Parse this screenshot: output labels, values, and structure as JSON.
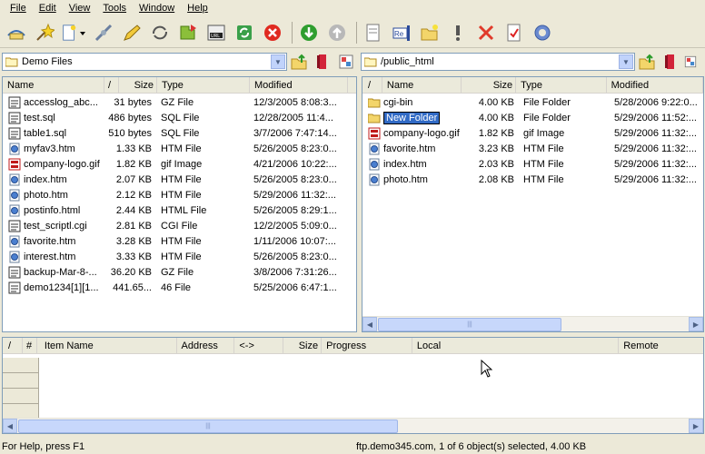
{
  "menu": [
    "File",
    "Edit",
    "View",
    "Tools",
    "Window",
    "Help"
  ],
  "toolbar_icons": [
    "connect-icon",
    "wizard-icon",
    "new-file-icon",
    "dropdown-arrow-icon",
    "disconnect-icon",
    "pencil-icon",
    "reconnect-icon",
    "transfer-icon",
    "url-icon",
    "refresh-icon",
    "stop-icon",
    "download-icon",
    "upload-icon",
    "properties-icon",
    "rename-icon",
    "new-folder-icon",
    "exclamation-icon",
    "delete-icon",
    "edit-icon",
    "settings-icon"
  ],
  "left": {
    "path": "Demo Files",
    "columns": [
      "Name",
      "/",
      "Size",
      "Type",
      "Modified"
    ],
    "files": [
      {
        "name": "accesslog_abc...",
        "size": "31 bytes",
        "type": "GZ File",
        "modified": "12/3/2005 8:08:3...",
        "icon": "gz"
      },
      {
        "name": "test.sql",
        "size": "486 bytes",
        "type": "SQL File",
        "modified": "12/28/2005 11:4...",
        "icon": "gz"
      },
      {
        "name": "table1.sql",
        "size": "510 bytes",
        "type": "SQL File",
        "modified": "3/7/2006 7:47:14...",
        "icon": "gz"
      },
      {
        "name": "myfav3.htm",
        "size": "1.33 KB",
        "type": "HTM File",
        "modified": "5/26/2005 8:23:0...",
        "icon": "htm"
      },
      {
        "name": "company-logo.gif",
        "size": "1.82 KB",
        "type": "gif Image",
        "modified": "4/21/2006 10:22:...",
        "icon": "gif"
      },
      {
        "name": "index.htm",
        "size": "2.07 KB",
        "type": "HTM File",
        "modified": "5/26/2005 8:23:0...",
        "icon": "htm"
      },
      {
        "name": "photo.htm",
        "size": "2.12 KB",
        "type": "HTM File",
        "modified": "5/29/2006 11:32:...",
        "icon": "htm"
      },
      {
        "name": "postinfo.html",
        "size": "2.44 KB",
        "type": "HTML File",
        "modified": "5/26/2005 8:29:1...",
        "icon": "htm"
      },
      {
        "name": "test_scriptl.cgi",
        "size": "2.81 KB",
        "type": "CGI File",
        "modified": "12/2/2005 5:09:0...",
        "icon": "gz"
      },
      {
        "name": "favorite.htm",
        "size": "3.28 KB",
        "type": "HTM File",
        "modified": "1/11/2006 10:07:...",
        "icon": "htm"
      },
      {
        "name": "interest.htm",
        "size": "3.33 KB",
        "type": "HTM File",
        "modified": "5/26/2005 8:23:0...",
        "icon": "htm"
      },
      {
        "name": "backup-Mar-8-...",
        "size": "36.20 KB",
        "type": "GZ File",
        "modified": "3/8/2006 7:31:26...",
        "icon": "gz"
      },
      {
        "name": "demo1234[1][1...",
        "size": "441.65...",
        "type": "46 File",
        "modified": "5/25/2006 6:47:1...",
        "icon": "gz"
      }
    ]
  },
  "right": {
    "path": "/public_html",
    "columns": [
      "/",
      "Name",
      "Size",
      "Type",
      "Modified"
    ],
    "files": [
      {
        "name": "cgi-bin",
        "size": "4.00 KB",
        "type": "File Folder",
        "modified": "5/28/2006 9:22:0...",
        "icon": "folder"
      },
      {
        "name": "New Folder",
        "size": "4.00 KB",
        "type": "File Folder",
        "modified": "5/29/2006 11:52:...",
        "icon": "folder",
        "editing": true
      },
      {
        "name": "company-logo.gif",
        "size": "1.82 KB",
        "type": "gif Image",
        "modified": "5/29/2006 11:32:...",
        "icon": "gif"
      },
      {
        "name": "favorite.htm",
        "size": "3.23 KB",
        "type": "HTM File",
        "modified": "5/29/2006 11:32:...",
        "icon": "htm"
      },
      {
        "name": "index.htm",
        "size": "2.03 KB",
        "type": "HTM File",
        "modified": "5/29/2006 11:32:...",
        "icon": "htm"
      },
      {
        "name": "photo.htm",
        "size": "2.08 KB",
        "type": "HTM File",
        "modified": "5/29/2006 11:32:...",
        "icon": "htm"
      }
    ]
  },
  "queue": {
    "columns": [
      "/",
      "#",
      "Item Name",
      "Address",
      "<->",
      "Size",
      "Progress",
      "Local",
      "Remote"
    ]
  },
  "status": {
    "help": "For Help, press F1",
    "info": "ftp.demo345.com, 1 of 6 object(s) selected, 4.00 KB"
  }
}
